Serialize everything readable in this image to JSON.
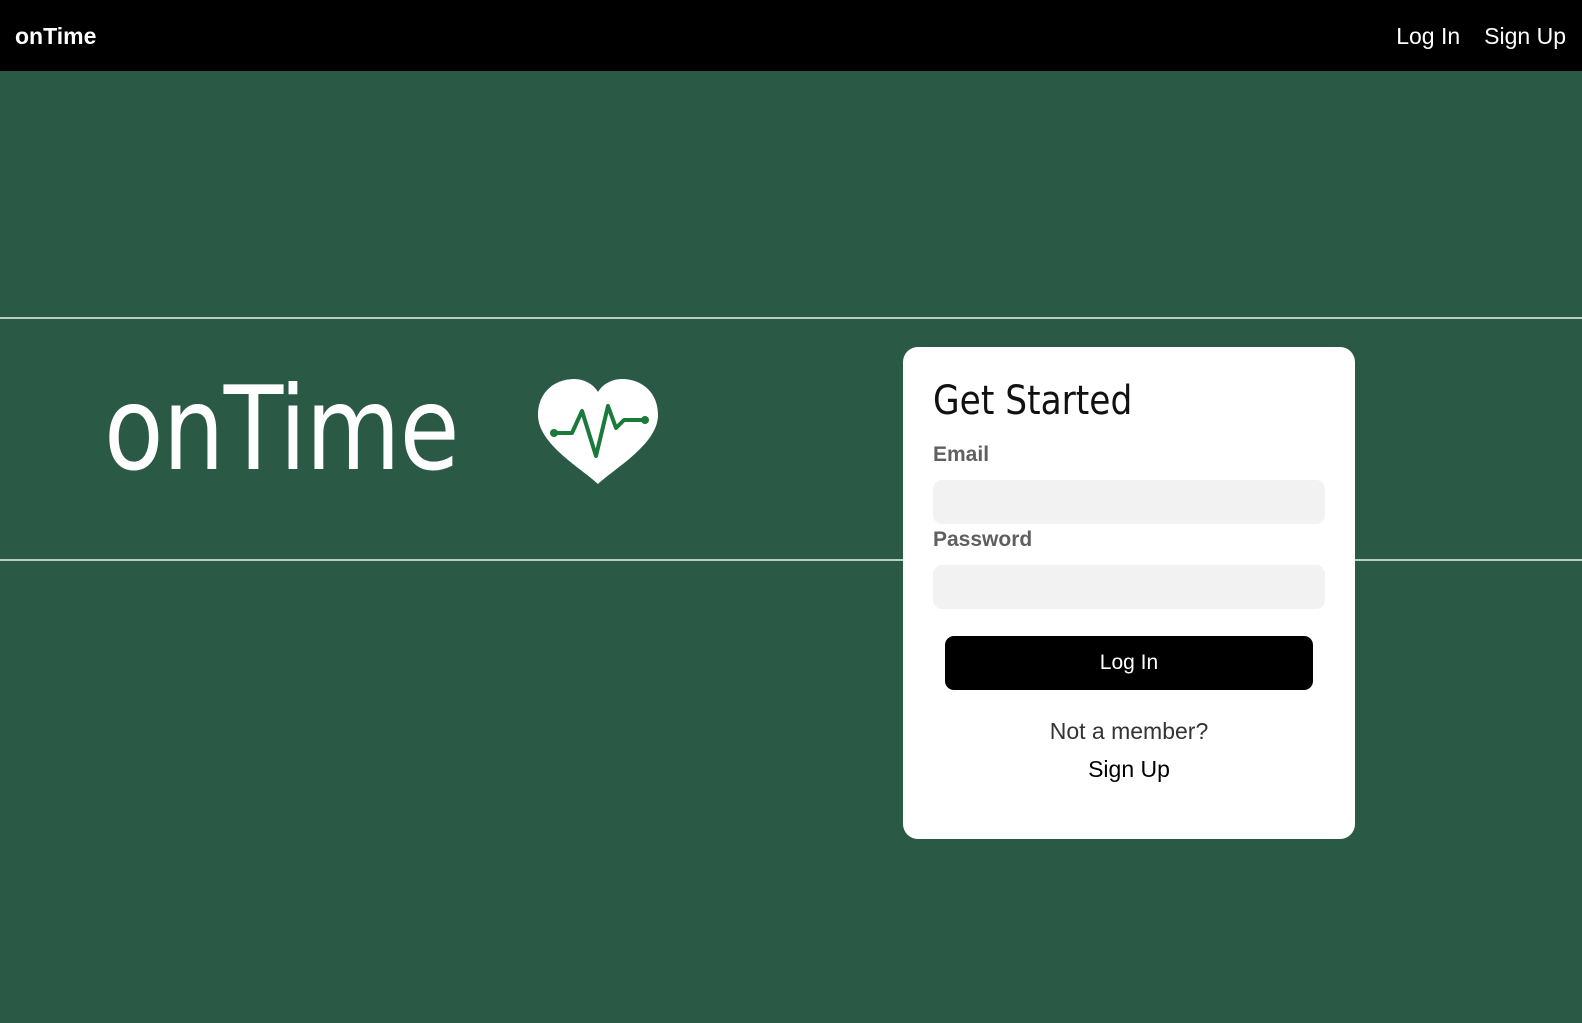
{
  "nav": {
    "brand": "onTime",
    "login_label": "Log In",
    "signup_label": "Sign Up"
  },
  "hero": {
    "title": "onTime",
    "icon": "heart-pulse-icon"
  },
  "login_card": {
    "title": "Get Started",
    "email_label": "Email",
    "email_value": "",
    "password_label": "Password",
    "password_value": "",
    "submit_label": "Log In",
    "not_member_text": "Not a member?",
    "signup_link": "Sign Up"
  },
  "colors": {
    "background": "#2a5a45",
    "navbar": "#000000",
    "card": "#ffffff",
    "input_bg": "#f2f2f3",
    "button": "#000000",
    "pulse_line": "#1a7a3a",
    "divider": "#b8cec4"
  }
}
